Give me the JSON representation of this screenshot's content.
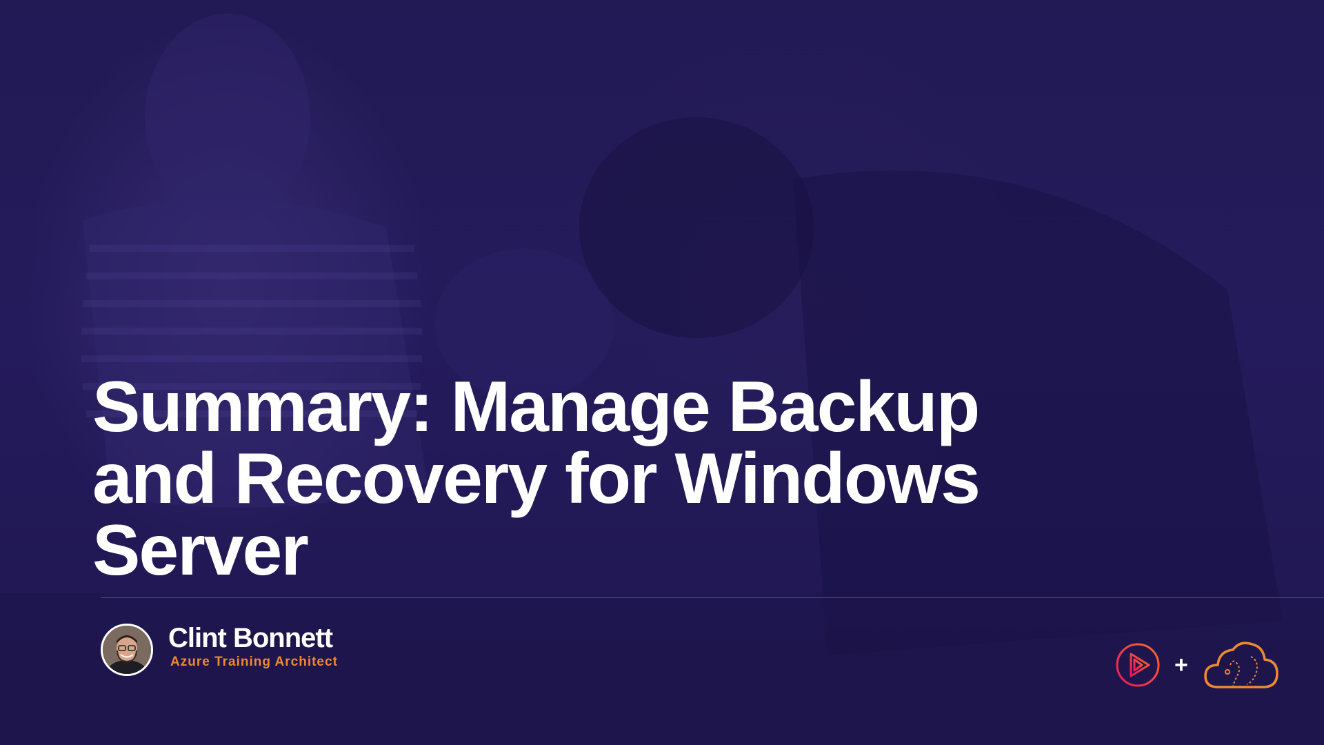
{
  "slide": {
    "title_lines": [
      "Summary: Manage Backup",
      "and Recovery for Windows",
      "Server"
    ],
    "presenter": {
      "name": "Clint Bonnett",
      "role": "Azure Training Architect"
    },
    "branding": {
      "plus": "+",
      "logos": [
        "play-logo-icon",
        "cloud-logo-icon"
      ]
    }
  },
  "colors": {
    "background": "#221a55",
    "title_text": "#ffffff",
    "role_accent": "#f08a2e",
    "play_logo_gradient": [
      "#f0145a",
      "#ff6a2a"
    ],
    "cloud_logo": "#f08a2e"
  }
}
